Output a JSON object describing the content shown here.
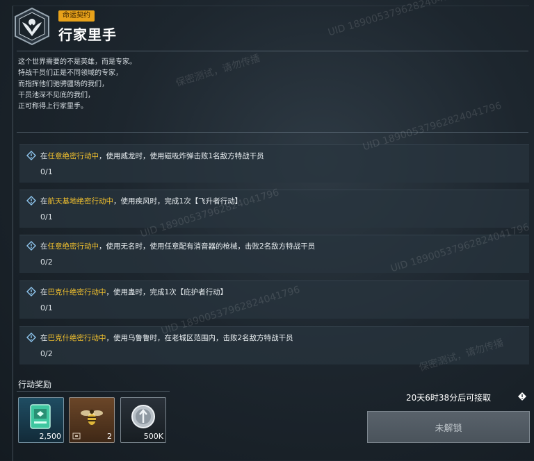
{
  "header": {
    "tag": "命运契约",
    "title": "行家里手"
  },
  "description": [
    "这个世界需要的不是英雄，而是专家。",
    "特战干员们正是不同领域的专家，",
    "而指挥他们驰骋疆场的我们，",
    "干员池深不见底的我们，",
    "正可称得上行家里手。"
  ],
  "tasks": [
    {
      "prefix": "在",
      "highlight": "任意绝密行动中",
      "rest": "，使用威龙时，使用磁吸炸弹击败1名敌方特战干员",
      "progress": "0/1"
    },
    {
      "prefix": "在",
      "highlight": "航天基地绝密行动中",
      "rest": "，使用疾风时，完成1次【飞升者行动】",
      "progress": "0/1"
    },
    {
      "prefix": "在",
      "highlight": "任意绝密行动中",
      "rest": "，使用无名时，使用任意配有消音器的枪械，击败2名敌方特战干员",
      "progress": "0/2"
    },
    {
      "prefix": "在",
      "highlight": "巴克什绝密行动中",
      "rest": "，使用蛊时，完成1次【庇护者行动】",
      "progress": "0/1"
    },
    {
      "prefix": "在",
      "highlight": "巴克什绝密行动中",
      "rest": "，使用乌鲁鲁时，在老城区范围内，击败2名敌方特战干员",
      "progress": "0/2"
    }
  ],
  "rewards": {
    "label": "行动奖励",
    "items": [
      {
        "icon": "token-card-icon",
        "count": "2,500",
        "bg": "#17344a"
      },
      {
        "icon": "wasp-insect-icon",
        "count": "2",
        "bg": "#5a3a22"
      },
      {
        "icon": "silver-coin-icon",
        "count": "500K",
        "bg": "#1e252c"
      }
    ]
  },
  "timer": "20天6时38分后可接取",
  "unlock_button": "未解锁",
  "watermarks": [
    "UID 18900537962824041796",
    "保密测试，请勿传播"
  ],
  "colors": {
    "accent": "#f2c12e",
    "tag_bg": "#e8a21a",
    "task_bg": "#28343e"
  }
}
